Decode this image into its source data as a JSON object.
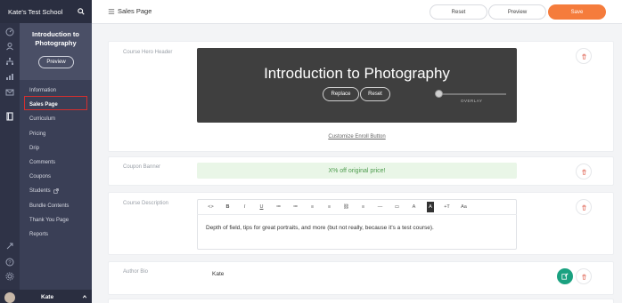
{
  "app": {
    "school_name": "Kate's Test School",
    "course_title": "Introduction to Photography",
    "preview_label": "Preview"
  },
  "sidebar": {
    "items": [
      {
        "label": "Information"
      },
      {
        "label": "Sales Page"
      },
      {
        "label": "Curriculum"
      },
      {
        "label": "Pricing"
      },
      {
        "label": "Drip"
      },
      {
        "label": "Comments"
      },
      {
        "label": "Coupons"
      },
      {
        "label": "Students"
      },
      {
        "label": "Bundle Contents"
      },
      {
        "label": "Thank You Page"
      },
      {
        "label": "Reports"
      }
    ],
    "user_name": "Kate"
  },
  "header": {
    "title": "Sales Page",
    "reset_label": "Reset",
    "preview_label": "Preview",
    "save_label": "Save"
  },
  "hero": {
    "section_label": "Course Hero Header",
    "title": "Introduction to Photography",
    "replace_label": "Replace",
    "reset_label": "Reset",
    "overlay_label": "OVERLAY",
    "customize_link": "Customize Enroll Button"
  },
  "coupon": {
    "section_label": "Coupon Banner",
    "text": "X% off original price!"
  },
  "description": {
    "section_label": "Course Description",
    "toolbar": [
      "<>",
      "B",
      "I",
      "U",
      "≔",
      "≔",
      "≡",
      "≡",
      "⛓",
      "≡",
      "—",
      "▭",
      "A",
      "A",
      "+T",
      "Aa"
    ],
    "text": "Depth of field, tips for great portraits, and more (but not really, because it's a test course)."
  },
  "author": {
    "section_label": "Author Bio",
    "name": "Kate"
  },
  "colors": {
    "sidebar_bg": "#2f3347",
    "accent": "#f57c3c",
    "edit_green": "#1aa180",
    "coupon_bg": "#e9f6e7"
  }
}
